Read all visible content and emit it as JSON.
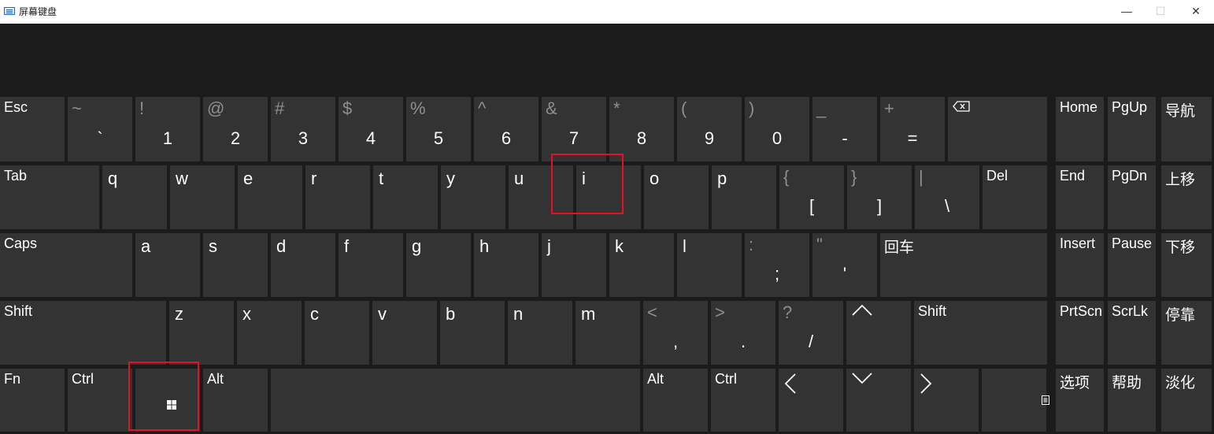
{
  "window": {
    "title": "屏幕键盘",
    "icon": "keyboard-icon",
    "controls": {
      "minimize": "—",
      "maximize": "☐",
      "close": "✕"
    }
  },
  "keyboard": {
    "row1": [
      {
        "id": "esc",
        "label": "Esc"
      },
      {
        "id": "backtick",
        "shift": "~",
        "main": "`"
      },
      {
        "id": "1",
        "shift": "!",
        "main": "1"
      },
      {
        "id": "2",
        "shift": "@",
        "main": "2"
      },
      {
        "id": "3",
        "shift": "#",
        "main": "3"
      },
      {
        "id": "4",
        "shift": "$",
        "main": "4"
      },
      {
        "id": "5",
        "shift": "%",
        "main": "5"
      },
      {
        "id": "6",
        "shift": "^",
        "main": "6"
      },
      {
        "id": "7",
        "shift": "&",
        "main": "7"
      },
      {
        "id": "8",
        "shift": "*",
        "main": "8"
      },
      {
        "id": "9",
        "shift": "(",
        "main": "9"
      },
      {
        "id": "0",
        "shift": ")",
        "main": "0"
      },
      {
        "id": "minus",
        "shift": "_",
        "main": "-"
      },
      {
        "id": "equals",
        "shift": "+",
        "main": "="
      },
      {
        "id": "backspace",
        "icon": "backspace-icon"
      }
    ],
    "row2": [
      {
        "id": "tab",
        "label": "Tab"
      },
      {
        "id": "q",
        "letter": "q"
      },
      {
        "id": "w",
        "letter": "w"
      },
      {
        "id": "e",
        "letter": "e"
      },
      {
        "id": "r",
        "letter": "r"
      },
      {
        "id": "t",
        "letter": "t"
      },
      {
        "id": "y",
        "letter": "y"
      },
      {
        "id": "u",
        "letter": "u"
      },
      {
        "id": "i",
        "letter": "i"
      },
      {
        "id": "o",
        "letter": "o"
      },
      {
        "id": "p",
        "letter": "p"
      },
      {
        "id": "lbracket",
        "shift": "{",
        "main": "["
      },
      {
        "id": "rbracket",
        "shift": "}",
        "main": "]"
      },
      {
        "id": "backslash",
        "shift": "|",
        "main": "\\"
      },
      {
        "id": "del",
        "label": "Del"
      }
    ],
    "row3": [
      {
        "id": "caps",
        "label": "Caps"
      },
      {
        "id": "a",
        "letter": "a"
      },
      {
        "id": "s",
        "letter": "s"
      },
      {
        "id": "d",
        "letter": "d"
      },
      {
        "id": "f",
        "letter": "f"
      },
      {
        "id": "g",
        "letter": "g"
      },
      {
        "id": "h",
        "letter": "h"
      },
      {
        "id": "j",
        "letter": "j"
      },
      {
        "id": "k",
        "letter": "k"
      },
      {
        "id": "l",
        "letter": "l"
      },
      {
        "id": "semicolon",
        "shift": ":",
        "main": ";"
      },
      {
        "id": "quote",
        "shift": "\"",
        "main": "'"
      },
      {
        "id": "enter",
        "label": "回车"
      }
    ],
    "row4": [
      {
        "id": "lshift",
        "label": "Shift"
      },
      {
        "id": "z",
        "letter": "z"
      },
      {
        "id": "x",
        "letter": "x"
      },
      {
        "id": "c",
        "letter": "c"
      },
      {
        "id": "v",
        "letter": "v"
      },
      {
        "id": "b",
        "letter": "b"
      },
      {
        "id": "n",
        "letter": "n"
      },
      {
        "id": "m",
        "letter": "m"
      },
      {
        "id": "comma",
        "shift": "<",
        "main": ","
      },
      {
        "id": "period",
        "shift": ">",
        "main": "."
      },
      {
        "id": "slash",
        "shift": "?",
        "main": "/"
      },
      {
        "id": "up",
        "icon": "up-arrow-icon",
        "glyph": "^"
      },
      {
        "id": "rshift",
        "label": "Shift"
      }
    ],
    "row5": [
      {
        "id": "fn",
        "label": "Fn"
      },
      {
        "id": "lctrl",
        "label": "Ctrl"
      },
      {
        "id": "win",
        "icon": "windows-logo-icon"
      },
      {
        "id": "lalt",
        "label": "Alt"
      },
      {
        "id": "space",
        "label": ""
      },
      {
        "id": "ralt",
        "label": "Alt"
      },
      {
        "id": "rctrl",
        "label": "Ctrl"
      },
      {
        "id": "left",
        "icon": "left-arrow-icon",
        "glyph": "<"
      },
      {
        "id": "down",
        "icon": "down-arrow-icon",
        "glyph": "v"
      },
      {
        "id": "right",
        "icon": "right-arrow-icon",
        "glyph": ">"
      },
      {
        "id": "menu",
        "icon": "menu-key-icon"
      }
    ],
    "right_pad": [
      [
        "Home",
        "PgUp",
        "导航"
      ],
      [
        "End",
        "PgDn",
        "上移"
      ],
      [
        "Insert",
        "Pause",
        "下移"
      ],
      [
        "PrtScn",
        "ScrLk",
        "停靠"
      ],
      [
        "选项",
        "帮助",
        "淡化"
      ]
    ],
    "highlighted_keys": [
      "i",
      "win"
    ],
    "highlight_color": "#e81123",
    "key_color": "#333333",
    "background_color": "#1b1b1b"
  }
}
